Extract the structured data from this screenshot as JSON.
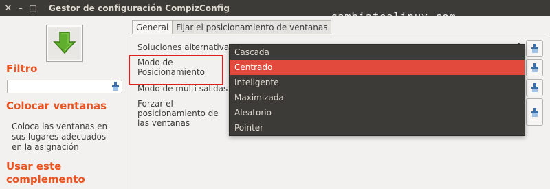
{
  "window": {
    "title": "Gestor de configuración CompizConfig",
    "watermark": "cambiatealinux.com"
  },
  "left": {
    "filter_heading": "Filtro",
    "filter_value": "",
    "section_heading": "Colocar ventanas",
    "description": "Coloca las ventanas en sus lugares adecuados en la asignación",
    "enable_heading": "Usar este complemento"
  },
  "tabs": [
    "General",
    "Fijar el posicionamiento de ventanas"
  ],
  "options": {
    "workarounds": "Soluciones alternativas",
    "placement_mode": "Modo de Posicionamiento",
    "multi_output": "Modo de multi salidas",
    "force_placement": "Forzar el posicionamiento de las ventanas"
  },
  "dropdown": {
    "items": [
      "Cascada",
      "Centrado",
      "Inteligente",
      "Maximizada",
      "Aleatorio",
      "Pointer"
    ],
    "selected": "Centrado"
  },
  "colors": {
    "accent": "#e95420",
    "selection": "#e34a3e",
    "menu_bg": "#3c3b37",
    "titlebar": "#3c3b37"
  },
  "icons": {
    "close": "close-icon",
    "minimize": "minimize-icon",
    "maximize": "maximize-icon",
    "plugin": "down-arrow-icon",
    "clear": "brush-icon",
    "reset": "brush-icon"
  }
}
